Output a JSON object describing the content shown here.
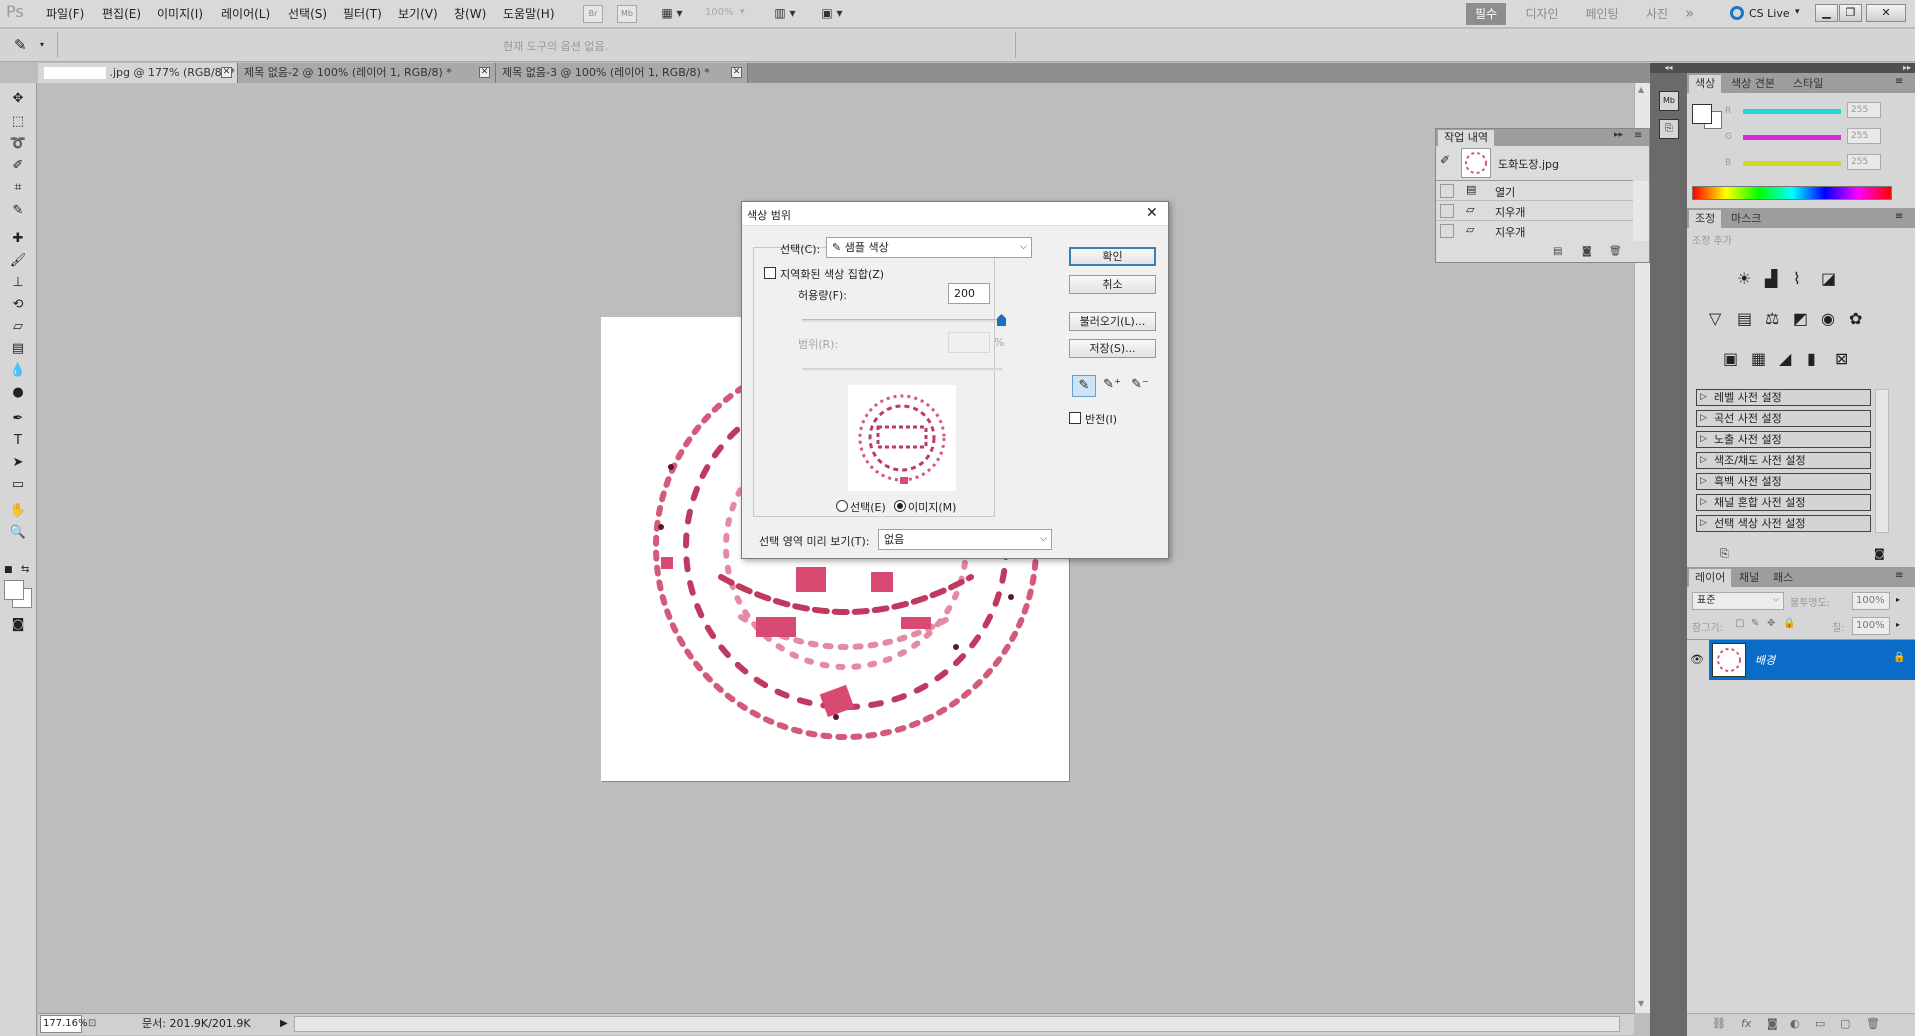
{
  "app": {
    "logo": "Ps",
    "cs_live": "CS Live"
  },
  "menu": [
    "파일(F)",
    "편집(E)",
    "이미지(I)",
    "레이어(L)",
    "선택(S)",
    "필터(T)",
    "보기(V)",
    "창(W)",
    "도움말(H)"
  ],
  "toolbar_top": {
    "zoom": "100%",
    "br": "Br",
    "mb": "Mb"
  },
  "workspaces": [
    "필수",
    "디자인",
    "페인팅",
    "사진"
  ],
  "options_hint": "현재 도구의 옵션 없음.",
  "tabs": [
    {
      "label": ".jpg @ 177% (RGB/8) *",
      "active": true
    },
    {
      "label": "제목 없음-2 @ 100% (레이어 1, RGB/8) *",
      "active": false
    },
    {
      "label": "제목 없음-3 @ 100% (레이어 1, RGB/8) *",
      "active": false
    }
  ],
  "status": {
    "zoom": "177.16%",
    "doc": "문서: 201.9K/201.9K"
  },
  "history": {
    "title": "작업 내역",
    "snapshot": "도화도장.jpg",
    "items": [
      "열기",
      "지우개",
      "지우개"
    ]
  },
  "color_panel": {
    "tabs": [
      "색상",
      "색상 견본",
      "스타일"
    ],
    "channels": [
      {
        "name": "R",
        "value": "255",
        "color": "#23d6d6"
      },
      {
        "name": "G",
        "value": "255",
        "color": "#d62bd6"
      },
      {
        "name": "B",
        "value": "255",
        "color": "#d6d62b"
      }
    ]
  },
  "adjust_panel": {
    "tabs": [
      "조정",
      "마스크"
    ],
    "add_label": "조정 추가",
    "presets": [
      "레벨 사전 설정",
      "곡선 사전 설정",
      "노출 사전 설정",
      "색조/채도 사전 설정",
      "흑백 사전 설정",
      "채널 혼합 사전 설정",
      "선택 색상 사전 설정"
    ]
  },
  "layers_panel": {
    "tabs": [
      "레이어",
      "채널",
      "패스"
    ],
    "blend_mode": "표준",
    "opacity_label": "불투명도:",
    "opacity": "100%",
    "lock_label": "잠그기:",
    "fill_label": "칠:",
    "fill": "100%",
    "layer_name": "배경"
  },
  "dialog": {
    "title": "색상 범위",
    "select_label": "선택(C):",
    "select_value": "샘플 색상",
    "localized_label": "지역화된 색상 집합(Z)",
    "fuzziness_label": "허용량(F):",
    "fuzziness_value": "200",
    "range_label": "범위(R):",
    "range_unit": "%",
    "radio_selection": "선택(E)",
    "radio_image": "이미지(M)",
    "preview_label": "선택 영역 미리 보기(T):",
    "preview_value": "없음",
    "ok": "확인",
    "cancel": "취소",
    "load": "불러오기(L)...",
    "save": "저장(S)...",
    "invert_label": "반전(I)",
    "fuzziness_slider": 1.0
  }
}
